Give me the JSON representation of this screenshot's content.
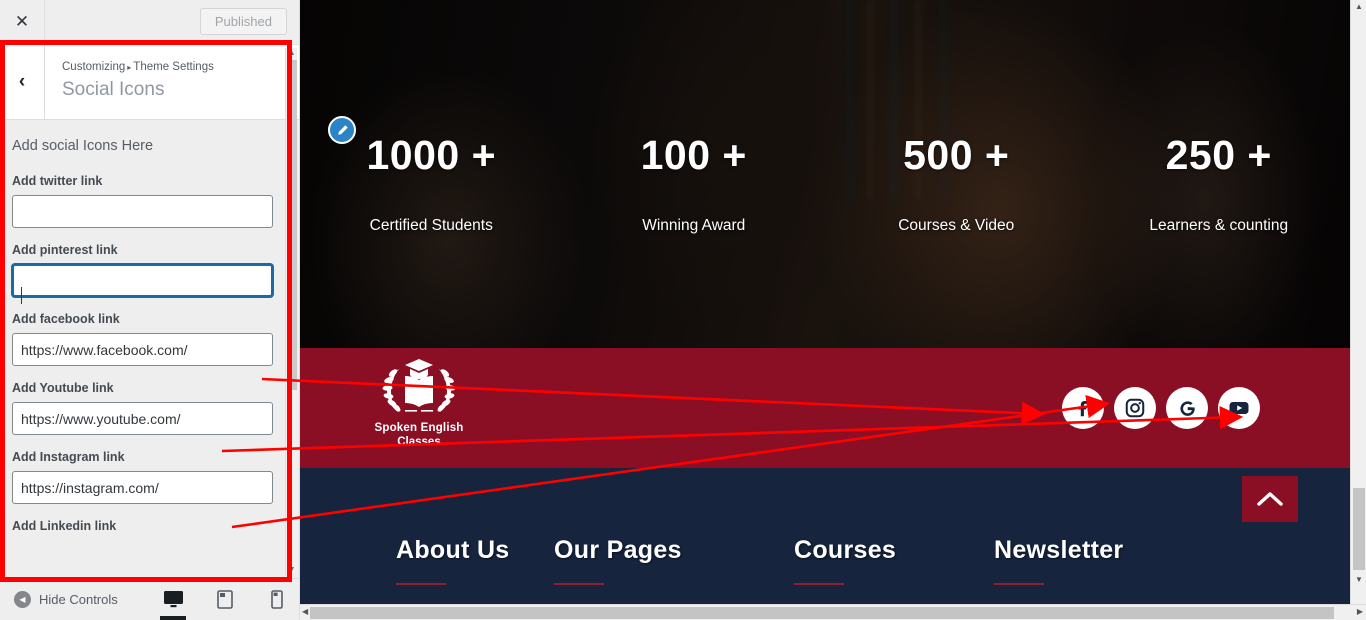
{
  "customizer": {
    "topbar": {
      "close_icon": "close-icon",
      "publish_label": "Published"
    },
    "header": {
      "back_icon": "chevron-left-icon",
      "breadcrumb_root": "Customizing",
      "breadcrumb_sep": "▸",
      "breadcrumb_parent": "Theme Settings",
      "section_title": "Social Icons"
    },
    "group_title": "Add social Icons Here",
    "fields": [
      {
        "label": "Add twitter link",
        "value": "",
        "focused": false
      },
      {
        "label": "Add pinterest link",
        "value": "",
        "focused": true
      },
      {
        "label": "Add facebook link",
        "value": "https://www.facebook.com/",
        "focused": false
      },
      {
        "label": "Add Youtube link",
        "value": "https://www.youtube.com/",
        "focused": false
      },
      {
        "label": "Add Instagram link",
        "value": "https://instagram.com/",
        "focused": false
      },
      {
        "label": "Add Linkedin link",
        "value": "",
        "focused": false
      }
    ],
    "footer": {
      "hide_controls_label": "Hide Controls",
      "devices": [
        {
          "name": "desktop-preview",
          "icon": "desktop-icon",
          "active": true
        },
        {
          "name": "tablet-preview",
          "icon": "tablet-icon",
          "active": false
        },
        {
          "name": "mobile-preview",
          "icon": "mobile-icon",
          "active": false
        }
      ]
    }
  },
  "preview": {
    "edit_pencil_icon": "pencil-edit-icon",
    "stats": [
      {
        "number": "1000 +",
        "label": "Certified Students"
      },
      {
        "number": "100 +",
        "label": "Winning Award"
      },
      {
        "number": "500 +",
        "label": "Courses & Video"
      },
      {
        "number": "250 +",
        "label": "Learners & counting"
      }
    ],
    "brand": {
      "logo_icon": "graduation-book-laurel-logo",
      "line1": "Spoken English",
      "line2": "Classes"
    },
    "social_icons": [
      {
        "name": "facebook-icon",
        "glyph": "f"
      },
      {
        "name": "instagram-icon",
        "glyph": "▣"
      },
      {
        "name": "google-icon",
        "glyph": "G"
      },
      {
        "name": "youtube-icon",
        "glyph": "▶"
      }
    ],
    "footer_columns": [
      {
        "title": "About Us"
      },
      {
        "title": "Our Pages"
      },
      {
        "title": "Courses"
      },
      {
        "title": "Newsletter"
      }
    ],
    "back_to_top_icon": "chevron-up-icon"
  },
  "colors": {
    "brand_red": "#8b0f24",
    "footer_navy": "#16243e",
    "annotation_red": "#ff0000",
    "focus_blue": "#1c6aa5",
    "pencil_blue": "#2b84c6"
  }
}
